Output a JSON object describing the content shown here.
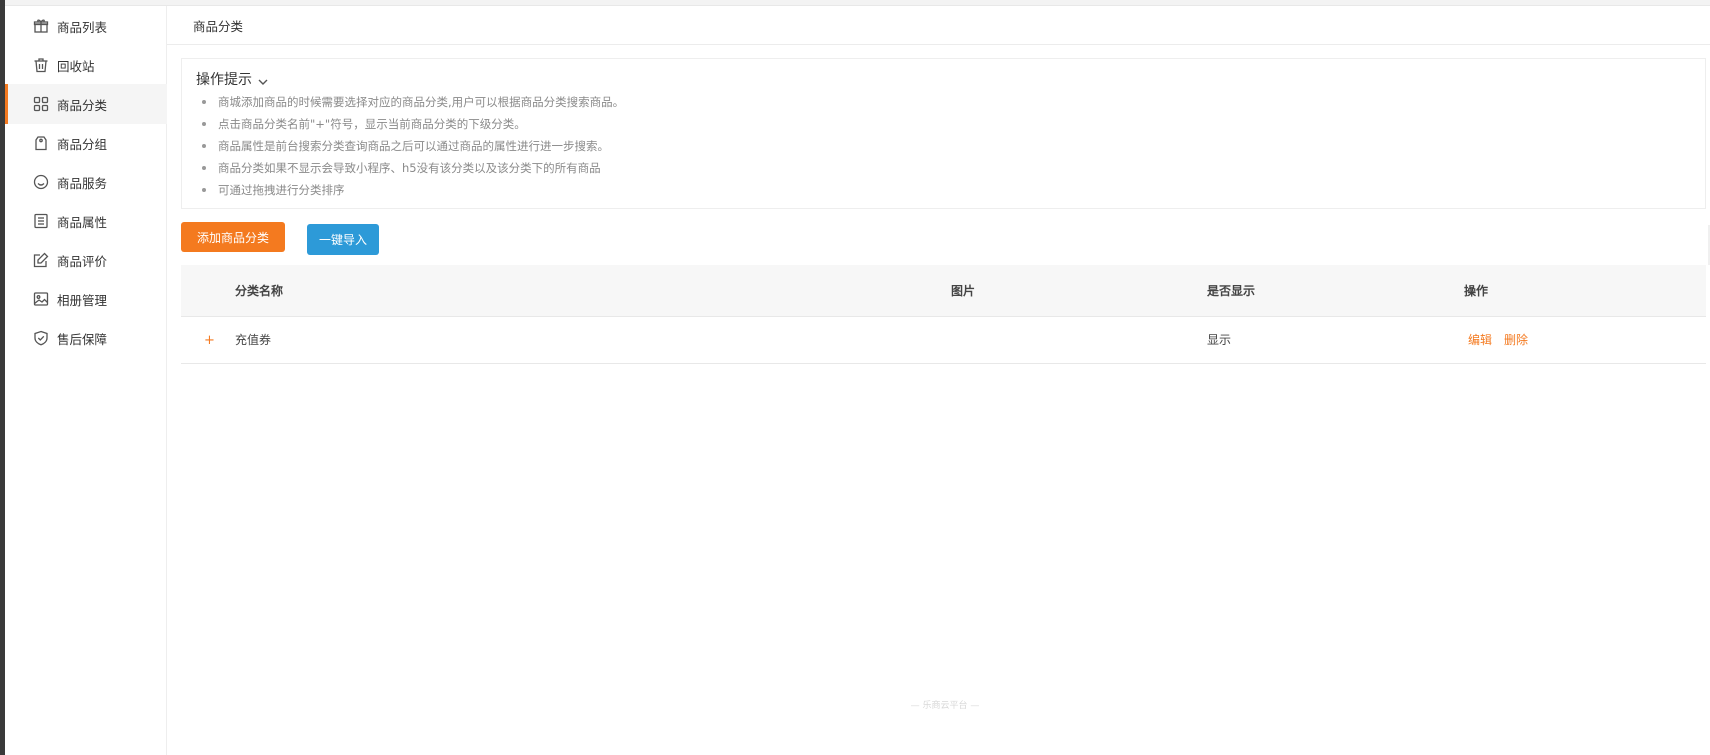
{
  "sidebar": {
    "items": [
      {
        "label": "商品列表",
        "icon": "gift-icon"
      },
      {
        "label": "回收站",
        "icon": "trash-icon"
      },
      {
        "label": "商品分类",
        "icon": "grid-icon",
        "active": true
      },
      {
        "label": "商品分组",
        "icon": "tag-icon"
      },
      {
        "label": "商品服务",
        "icon": "smile-icon"
      },
      {
        "label": "商品属性",
        "icon": "list-icon"
      },
      {
        "label": "商品评价",
        "icon": "edit-icon"
      },
      {
        "label": "相册管理",
        "icon": "image-icon"
      },
      {
        "label": "售后保障",
        "icon": "shield-icon"
      }
    ]
  },
  "header": {
    "title": "商品分类"
  },
  "tips": {
    "title": "操作提示",
    "items": [
      "商城添加商品的时候需要选择对应的商品分类,用户可以根据商品分类搜索商品。",
      "点击商品分类名前\"+\"符号，显示当前商品分类的下级分类。",
      "商品属性是前台搜索分类查询商品之后可以通过商品的属性进行进一步搜索。",
      "商品分类如果不显示会导致小程序、h5没有该分类以及该分类下的所有商品",
      "可通过拖拽进行分类排序"
    ]
  },
  "buttons": {
    "add": "添加商品分类",
    "import": "一键导入"
  },
  "table": {
    "columns": [
      "分类名称",
      "图片",
      "是否显示",
      "操作"
    ],
    "rows": [
      {
        "expand": "+",
        "name": "充值券",
        "image": "",
        "display": "显示",
        "actions": [
          "编辑",
          "删除"
        ]
      }
    ]
  },
  "footer": "— 乐商云平台 —",
  "colors": {
    "accent": "#f47a20",
    "primary_blue": "#2d9ad8"
  }
}
